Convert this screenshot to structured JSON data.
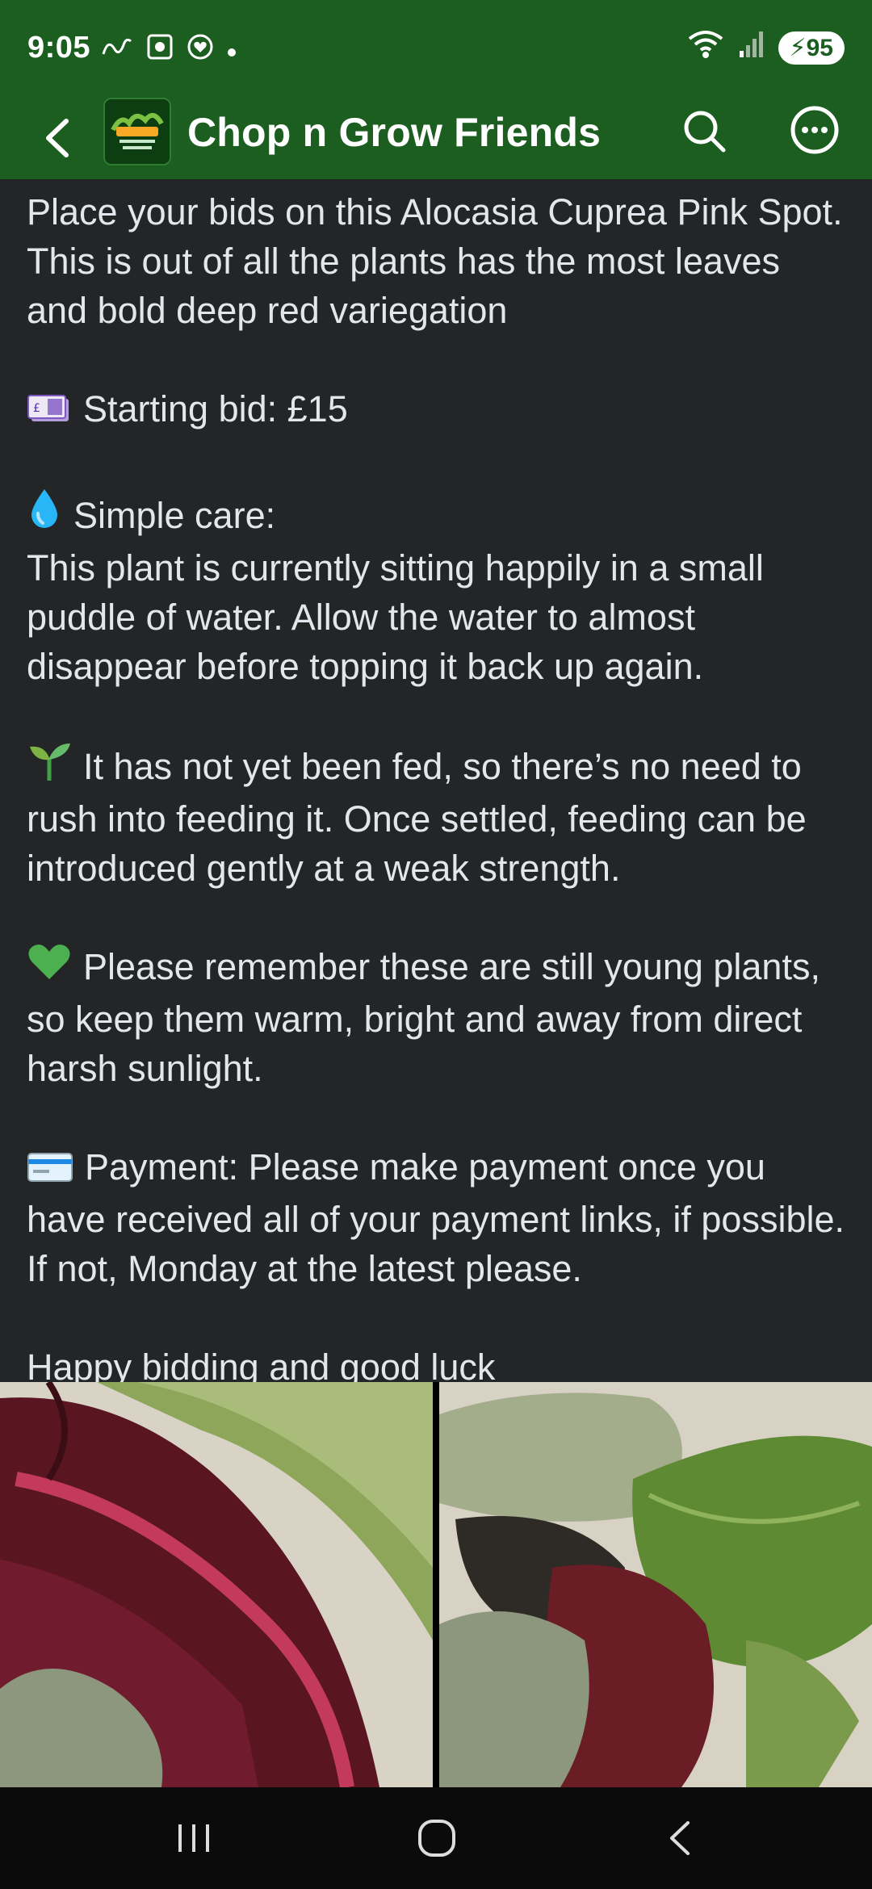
{
  "status_bar": {
    "time": "9:05",
    "battery": "95"
  },
  "header": {
    "title": "Chop n Grow Friends"
  },
  "post": {
    "intro": "Place your bids on this Alocasia Cuprea Pink Spot. This is out of all the plants has the most leaves and bold deep red variegation",
    "starting_bid": "Starting bid: £15",
    "care_title": "Simple care:",
    "care_text": "This plant is currently sitting happily in a small puddle of water. Allow the water to almost disappear before topping it back up again.",
    "feeding_text": "It has not yet been fed, so there’s no need to rush into feeding it. Once settled, feeding can be introduced gently at a weak strength.",
    "reminder_text": "Please remember these are still young plants, so keep them warm, bright and away from direct harsh sunlight.",
    "payment_text": "Payment: Please make payment once you have received all of your payment links, if possible. If not, Monday at the latest please.",
    "closing": "Happy bidding and good luck"
  },
  "icons": {
    "money": "pound-banknote-icon",
    "water": "droplet-icon",
    "sprout": "seedling-icon",
    "heart": "green-heart-icon",
    "card": "credit-card-icon"
  },
  "colors": {
    "header_bg": "#1b5e20",
    "content_bg": "#242526"
  }
}
